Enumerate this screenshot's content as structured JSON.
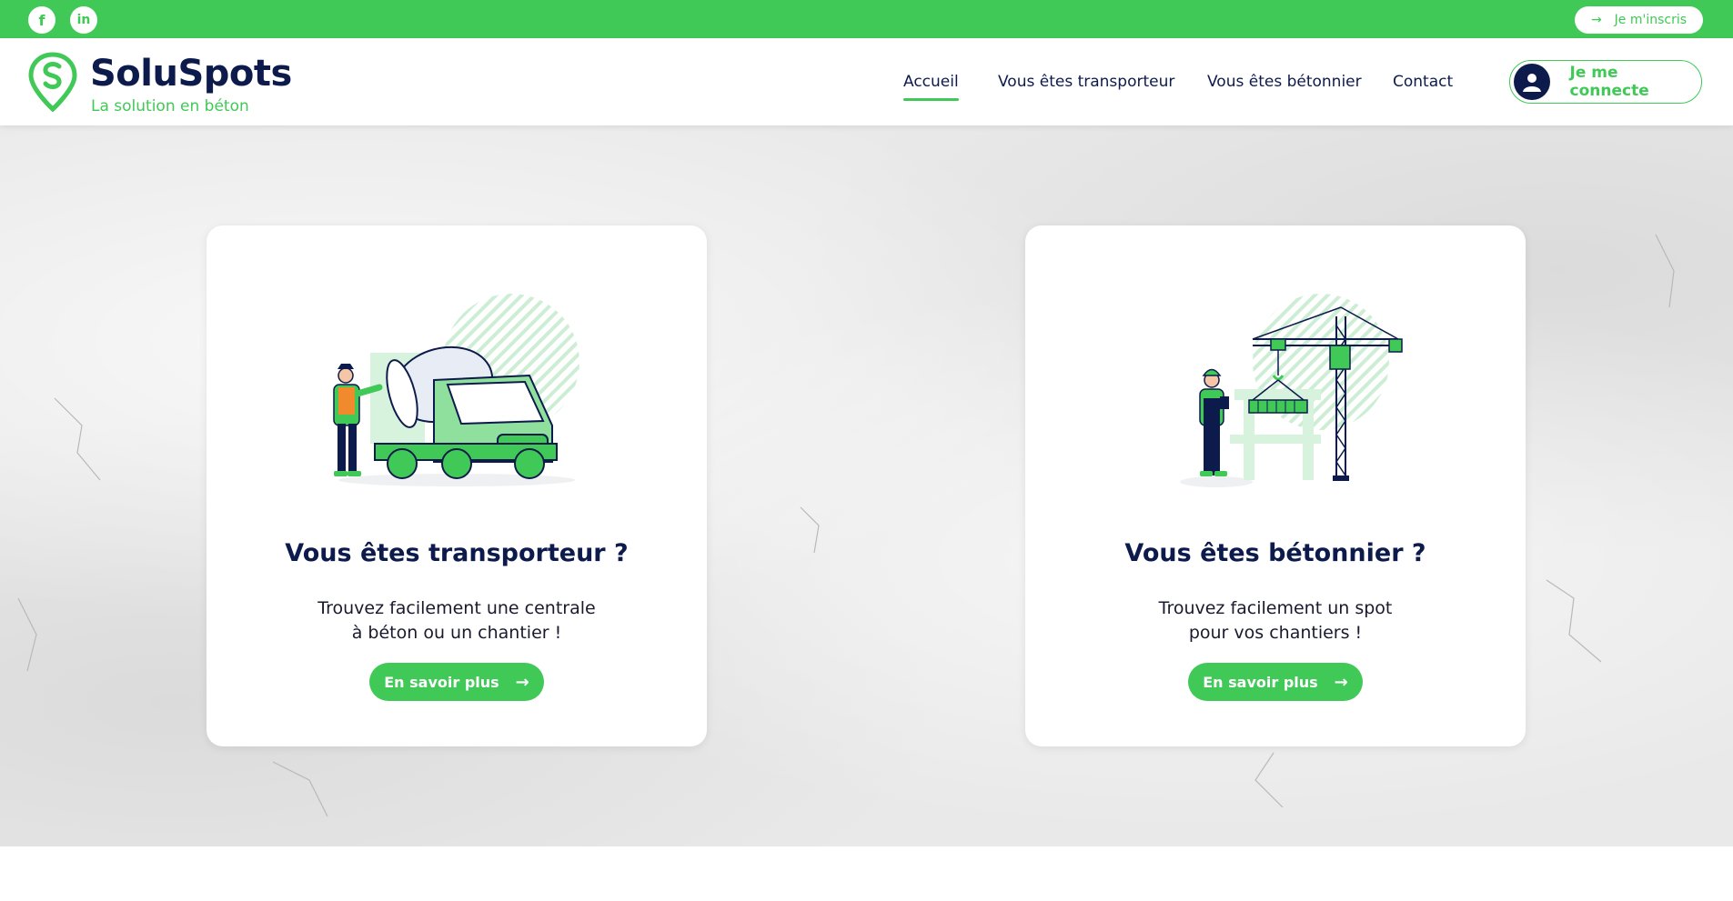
{
  "topbar": {
    "social": [
      {
        "name": "facebook",
        "glyph": "f"
      },
      {
        "name": "linkedin",
        "glyph": "in"
      }
    ],
    "signup_label": "Je m'inscris",
    "signup_arrow": "→"
  },
  "header": {
    "logo_name": "SoluSpots",
    "logo_tagline": "La solution en béton",
    "nav": [
      "Accueil",
      "Vous êtes transporteur",
      "Vous êtes bétonnier",
      "Contact"
    ],
    "active_nav": "Accueil",
    "login_label": "Je me connecte"
  },
  "cards": [
    {
      "title": "Vous êtes transporteur ?",
      "text_line1": "Trouvez facilement une centrale",
      "text_line2": "à béton ou un chantier !",
      "button_label": "En savoir plus",
      "button_arrow": "→",
      "illustration": "concrete-mixer-truck"
    },
    {
      "title": "Vous êtes bétonnier ?",
      "text_line1": "Trouvez facilement un spot",
      "text_line2": "pour vos chantiers !",
      "button_label": "En savoir plus",
      "button_arrow": "→",
      "illustration": "construction-crane"
    }
  ],
  "colors": {
    "brand_green": "#40c957",
    "navy": "#0d1b4c",
    "background": "#e9e9e9"
  }
}
